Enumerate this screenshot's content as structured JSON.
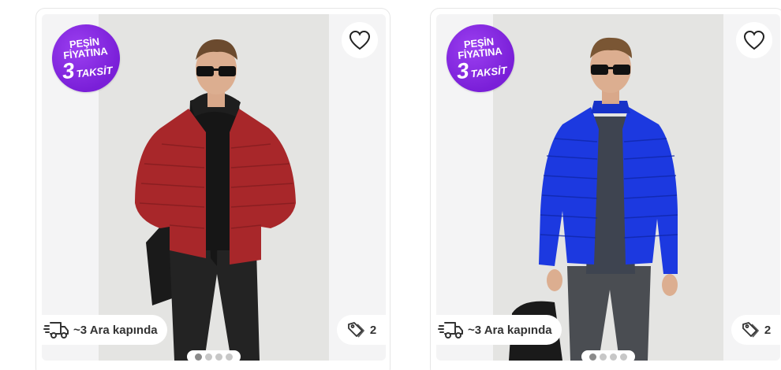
{
  "products": [
    {
      "promo_badge": {
        "line1": "PEŞİN",
        "line2": "FİYATINA",
        "number": "3",
        "word": "TAKSİT"
      },
      "delivery_text": "~3 Ara kapında",
      "color_variant_count": "2",
      "jacket_color": "#a8272a",
      "image_dots": 4,
      "active_dot": 0
    },
    {
      "promo_badge": {
        "line1": "PEŞİN",
        "line2": "FİYATINA",
        "number": "3",
        "word": "TAKSİT"
      },
      "delivery_text": "~3 Ara kapında",
      "color_variant_count": "2",
      "jacket_color": "#1c39e0",
      "image_dots": 4,
      "active_dot": 0
    }
  ],
  "colors": {
    "badge_purple": "#7a1fd8",
    "text_dark": "#333333"
  },
  "icons": [
    "heart-icon",
    "delivery-truck-icon",
    "price-tag-icon"
  ]
}
